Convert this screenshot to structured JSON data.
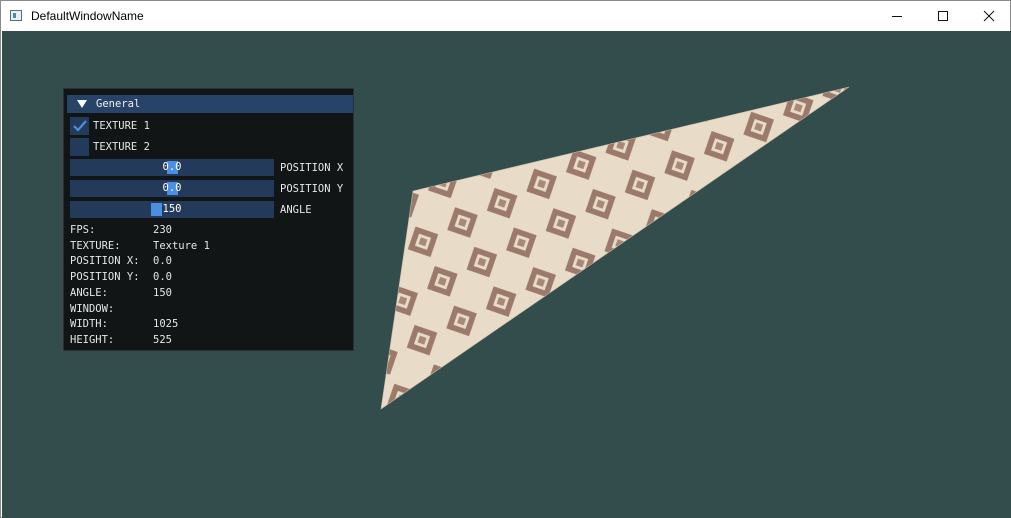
{
  "window": {
    "title": "DefaultWindowName"
  },
  "panel": {
    "header": "General",
    "checkboxes": [
      {
        "label": "TEXTURE 1",
        "checked": true
      },
      {
        "label": "TEXTURE 2",
        "checked": false
      }
    ],
    "sliders": [
      {
        "label": "POSITION X",
        "value": "0.0",
        "fraction": 0.5
      },
      {
        "label": "POSITION Y",
        "value": "0.0",
        "fraction": 0.5
      },
      {
        "label": "ANGLE",
        "value": "150",
        "fraction": 0.42
      }
    ],
    "stats": [
      {
        "key": "FPS:",
        "value": "230"
      },
      {
        "key": "TEXTURE:",
        "value": "Texture 1"
      },
      {
        "key": "POSITION X:",
        "value": "0.0"
      },
      {
        "key": "POSITION Y:",
        "value": "0.0"
      },
      {
        "key": "ANGLE:",
        "value": "150"
      },
      {
        "key": "WINDOW:",
        "value": ""
      },
      {
        "key": "WIDTH:",
        "value": "1025"
      },
      {
        "key": "HEIGHT:",
        "value": "525"
      }
    ]
  },
  "colors": {
    "background": "#334c4c",
    "panel": "#121515",
    "header": "#274468",
    "frame": "#243a5a",
    "accent": "#4b8fe0",
    "texture_light": "#e6d9c4",
    "texture_dark": "#9d7c6d"
  }
}
